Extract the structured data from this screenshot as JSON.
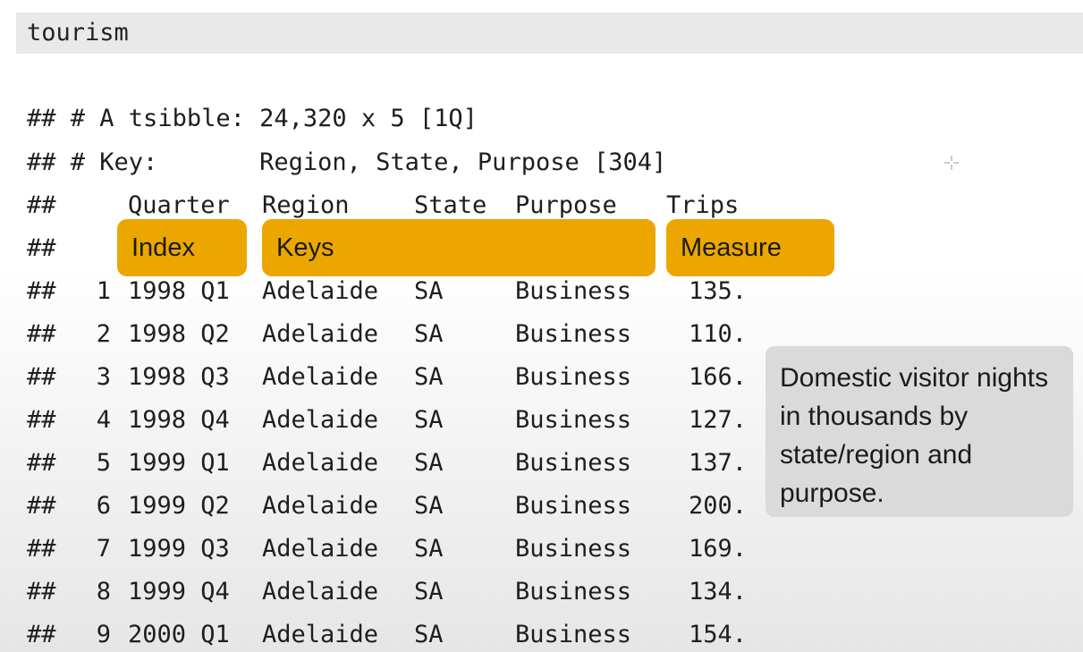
{
  "input": {
    "code": "tourism"
  },
  "output": {
    "prefix": "##",
    "summary_line": "# A tsibble: 24,320 x 5 [1Q]",
    "key_line": "# Key:       Region, State, Purpose [304]",
    "columns": [
      "Quarter",
      "Region",
      "State",
      "Purpose",
      "Trips"
    ],
    "rows": [
      {
        "n": "1",
        "quarter": "1998 Q1",
        "region": "Adelaide",
        "state": "SA",
        "purpose": "Business",
        "trips": "135."
      },
      {
        "n": "2",
        "quarter": "1998 Q2",
        "region": "Adelaide",
        "state": "SA",
        "purpose": "Business",
        "trips": "110."
      },
      {
        "n": "3",
        "quarter": "1998 Q3",
        "region": "Adelaide",
        "state": "SA",
        "purpose": "Business",
        "trips": "166."
      },
      {
        "n": "4",
        "quarter": "1998 Q4",
        "region": "Adelaide",
        "state": "SA",
        "purpose": "Business",
        "trips": "127."
      },
      {
        "n": "5",
        "quarter": "1999 Q1",
        "region": "Adelaide",
        "state": "SA",
        "purpose": "Business",
        "trips": "137."
      },
      {
        "n": "6",
        "quarter": "1999 Q2",
        "region": "Adelaide",
        "state": "SA",
        "purpose": "Business",
        "trips": "200."
      },
      {
        "n": "7",
        "quarter": "1999 Q3",
        "region": "Adelaide",
        "state": "SA",
        "purpose": "Business",
        "trips": "169."
      },
      {
        "n": "8",
        "quarter": "1999 Q4",
        "region": "Adelaide",
        "state": "SA",
        "purpose": "Business",
        "trips": "134."
      },
      {
        "n": "9",
        "quarter": "2000 Q1",
        "region": "Adelaide",
        "state": "SA",
        "purpose": "Business",
        "trips": "154."
      }
    ]
  },
  "annotations": {
    "index_label": "Index",
    "keys_label": "Keys",
    "measure_label": "Measure",
    "note": "Domestic visitor nights in thousands by state/region and purpose.",
    "tag_color": "#eba700",
    "note_color": "#dadada"
  },
  "icons": {
    "cursor": "crosshair-icon"
  }
}
